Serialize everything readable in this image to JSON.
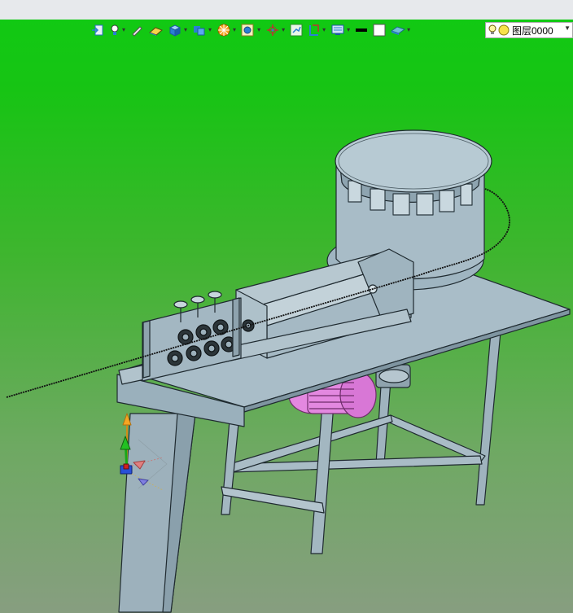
{
  "toolbar": {
    "icons": [
      {
        "name": "import-icon",
        "dropdown": false
      },
      {
        "name": "light-icon",
        "dropdown": true
      },
      {
        "name": "pencil-icon",
        "dropdown": false
      },
      {
        "name": "eraser-icon",
        "dropdown": false
      },
      {
        "name": "cube-view-icon",
        "dropdown": true
      },
      {
        "name": "layers-stack-icon",
        "dropdown": true
      },
      {
        "name": "orange-wheel-icon",
        "dropdown": true
      },
      {
        "name": "zoom-icon",
        "dropdown": true
      },
      {
        "name": "crosshair-icon",
        "dropdown": true
      },
      {
        "name": "fit-view-icon",
        "dropdown": false
      },
      {
        "name": "section-icon",
        "dropdown": true
      },
      {
        "name": "display-icon",
        "dropdown": true
      },
      {
        "name": "line-color-icon",
        "dropdown": false
      },
      {
        "name": "fill-color-icon",
        "dropdown": false
      },
      {
        "name": "plane-icon",
        "dropdown": true
      }
    ],
    "layer_label": "图层0000",
    "colors": {
      "accent_blue": "#2a7fd4",
      "accent_orange": "#f5a623"
    }
  },
  "viewport": {
    "background_top": "#11c913",
    "background_bottom": "#879e80",
    "model_color": "#9fb4bf",
    "motor_color": "#e080e0"
  }
}
